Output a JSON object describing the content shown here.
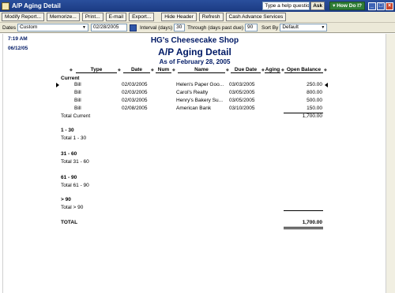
{
  "window": {
    "title": "A/P Aging Detail",
    "help_placeholder": "Type a help question",
    "ask_label": "Ask",
    "howdoi_label": "How Do I?"
  },
  "toolbar": {
    "modify_report": "Modify Report...",
    "memorize": "Memorize...",
    "print": "Print...",
    "email": "E-mail",
    "export": "Export...",
    "hide_header": "Hide Header",
    "refresh": "Refresh",
    "cash_advance": "Cash Advance Services"
  },
  "filters": {
    "dates_label": "Dates",
    "dates_value": "Custom",
    "date_value": "02/28/2005",
    "interval_label": "Interval (days)",
    "interval_value": "30",
    "through_label": "Through (days past due)",
    "through_value": "90",
    "sortby_label": "Sort By",
    "sortby_value": "Default"
  },
  "report": {
    "time": "7:19 AM",
    "date": "06/12/05",
    "company": "HG's Cheesecake Shop",
    "title": "A/P Aging Detail",
    "subtitle": "As of February 28, 2005",
    "columns": [
      "Type",
      "Date",
      "Num",
      "Name",
      "Due Date",
      "Aging",
      "Open Balance"
    ],
    "sections": {
      "current": "Current",
      "total_current": "Total Current",
      "total_current_value": "1,700.00",
      "s1_30": "1 - 30",
      "total_1_30": "Total 1 - 30",
      "s31_60": "31 - 60",
      "total_31_60": "Total 31 - 60",
      "s61_90": "61 - 90",
      "total_61_90": "Total 61 - 90",
      "s90": "> 90",
      "total_90": "Total > 90",
      "total": "TOTAL",
      "total_value": "1,700.00"
    },
    "rows": [
      {
        "type": "Bill",
        "date": "02/03/2005",
        "num": "",
        "name": "Helen's Paper Goo...",
        "due": "03/03/2005",
        "aging": "",
        "balance": "250.00"
      },
      {
        "type": "Bill",
        "date": "02/03/2005",
        "num": "",
        "name": "Carol's Realty",
        "due": "03/05/2005",
        "aging": "",
        "balance": "800.00"
      },
      {
        "type": "Bill",
        "date": "02/03/2005",
        "num": "",
        "name": "Henry's Bakery Su...",
        "due": "03/05/2005",
        "aging": "",
        "balance": "500.00"
      },
      {
        "type": "Bill",
        "date": "02/08/2005",
        "num": "",
        "name": "American Bank",
        "due": "03/10/2005",
        "aging": "",
        "balance": "150.00"
      }
    ]
  }
}
